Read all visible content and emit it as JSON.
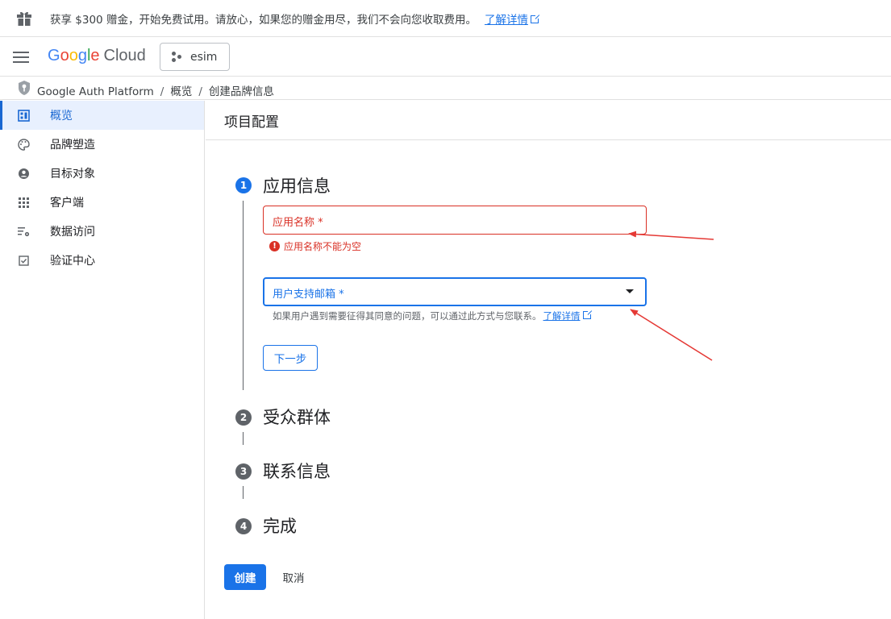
{
  "banner": {
    "icon": "gift-icon",
    "text": "获享 $300 赠金，开始免费试用。请放心，如果您的赠金用尽，我们不会向您收取费用。",
    "link": "了解详情"
  },
  "topbar": {
    "logo_google": [
      "G",
      "o",
      "o",
      "g",
      "l",
      "e"
    ],
    "logo_cloud": "Cloud",
    "project": "esim"
  },
  "breadcrumb": {
    "root": "Google Auth Platform",
    "level1": "概览",
    "level2": "创建品牌信息"
  },
  "sidebar": {
    "items": [
      {
        "label": "概览",
        "icon": "dashboard-icon",
        "active": true
      },
      {
        "label": "品牌塑造",
        "icon": "palette-icon",
        "active": false
      },
      {
        "label": "目标对象",
        "icon": "person-icon",
        "active": false
      },
      {
        "label": "客户端",
        "icon": "apps-grid-icon",
        "active": false
      },
      {
        "label": "数据访问",
        "icon": "data-settings-icon",
        "active": false
      },
      {
        "label": "验证中心",
        "icon": "checkbox-icon",
        "active": false
      }
    ]
  },
  "main": {
    "title": "项目配置",
    "steps": [
      {
        "num": "1",
        "title": "应用信息"
      },
      {
        "num": "2",
        "title": "受众群体"
      },
      {
        "num": "3",
        "title": "联系信息"
      },
      {
        "num": "4",
        "title": "完成"
      }
    ],
    "app_name_placeholder": "应用名称 *",
    "app_name_error": "应用名称不能为空",
    "email_placeholder": "用户支持邮箱 *",
    "email_helper": "如果用户遇到需要征得其同意的问题，可以通过此方式与您联系。",
    "email_helper_link": "了解详情",
    "next_button": "下一步",
    "create_button": "创建",
    "cancel_button": "取消"
  },
  "colors": {
    "accent": "#1a73e8",
    "error": "#d93025",
    "annotation_arrow": "#e53935"
  }
}
